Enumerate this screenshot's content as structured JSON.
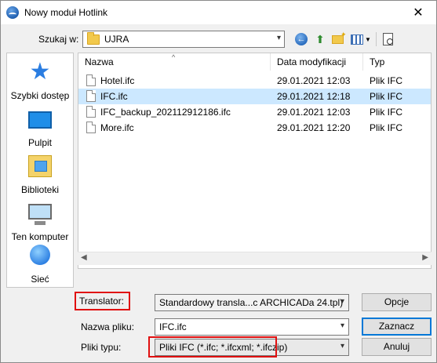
{
  "window": {
    "title": "Nowy moduł Hotlink",
    "close_glyph": "✕"
  },
  "lookin": {
    "label": "Szukaj w:",
    "value": "UJRA"
  },
  "toolbar": {
    "icons": [
      "back-icon",
      "up-folder-icon",
      "new-folder-icon",
      "views-menu-icon",
      "preview-icon"
    ]
  },
  "places": [
    {
      "label": "Szybki dostęp",
      "icon": "star-icon"
    },
    {
      "label": "Pulpit",
      "icon": "desktop-icon"
    },
    {
      "label": "Biblioteki",
      "icon": "library-icon"
    },
    {
      "label": "Ten komputer",
      "icon": "computer-icon"
    },
    {
      "label": "Sieć",
      "icon": "network-icon"
    }
  ],
  "filelist": {
    "columns": [
      "Nazwa",
      "Data modyfikacji",
      "Typ"
    ],
    "rows": [
      {
        "name": "Hotel.ifc",
        "date": "29.01.2021 12:03",
        "type": "Plik IFC",
        "selected": false
      },
      {
        "name": "IFC.ifc",
        "date": "29.01.2021 12:18",
        "type": "Plik IFC",
        "selected": true
      },
      {
        "name": "IFC_backup_202112912186.ifc",
        "date": "29.01.2021 12:03",
        "type": "Plik IFC",
        "selected": false
      },
      {
        "name": "More.ifc",
        "date": "29.01.2021 12:20",
        "type": "Plik IFC",
        "selected": false
      }
    ]
  },
  "form": {
    "translator_label": "Translator:",
    "translator_value": "Standardowy transla...c ARCHICADa 24.tpl)",
    "filename_label": "Nazwa pliku:",
    "filename_value": "IFC.ifc",
    "filetype_label": "Pliki typu:",
    "filetype_value": "Pliki IFC (*.ifc; *.ifcxml; *.ifczip)"
  },
  "buttons": {
    "options": "Opcje",
    "open": "Zaznacz",
    "cancel": "Anuluj"
  },
  "colors": {
    "selection": "#cce8ff",
    "highlight_box": "#e01010",
    "default_button_border": "#0078d7"
  }
}
